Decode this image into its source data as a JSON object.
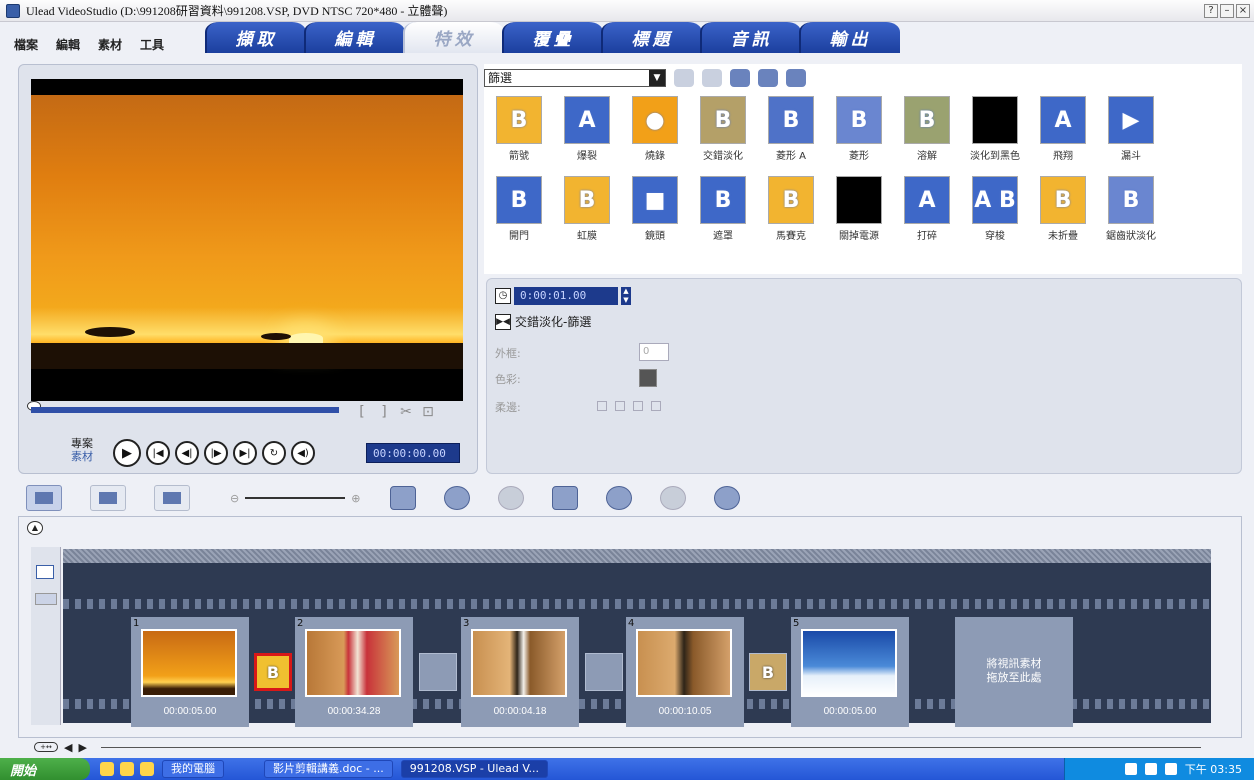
{
  "window": {
    "title": "Ulead VideoStudio (D:\\991208研習資料\\991208.VSP, DVD NTSC 720*480 - 立體聲)",
    "controls": [
      "?",
      "–",
      "×"
    ]
  },
  "menu": [
    "檔案",
    "編輯",
    "素材",
    "工具"
  ],
  "tabs": [
    {
      "label": "擷取",
      "active": false
    },
    {
      "label": "編輯",
      "active": false
    },
    {
      "label": "特效",
      "active": true
    },
    {
      "label": "覆疊",
      "active": false
    },
    {
      "label": "標題",
      "active": false
    },
    {
      "label": "音訊",
      "active": false
    },
    {
      "label": "輸出",
      "active": false
    }
  ],
  "preview": {
    "project_label": "專案",
    "clip_label": "素材",
    "timecode": "00:00:00.00",
    "trim_buttons": [
      "[",
      "]",
      "✂",
      "⊡"
    ]
  },
  "library": {
    "filter": "篩選",
    "effects": [
      {
        "label": "箭號",
        "glyph": "B",
        "color": "#f2b430"
      },
      {
        "label": "爆裂",
        "glyph": "A",
        "color": "#3e68c8"
      },
      {
        "label": "燒錄",
        "glyph": "●",
        "color": "#f2a018"
      },
      {
        "label": "交錯淡化",
        "glyph": "B",
        "color": "#b4a068"
      },
      {
        "label": "菱形 A",
        "glyph": "B",
        "color": "#4f72c8"
      },
      {
        "label": "菱形",
        "glyph": "B",
        "color": "#6a86d0"
      },
      {
        "label": "溶解",
        "glyph": "B",
        "color": "#9aa270"
      },
      {
        "label": "淡化到黑色",
        "glyph": "",
        "color": "#000000"
      },
      {
        "label": "飛翔",
        "glyph": "A",
        "color": "#3e68c8"
      },
      {
        "label": "漏斗",
        "glyph": "▶",
        "color": "#3e68c8"
      },
      {
        "label": "開門",
        "glyph": "B",
        "color": "#3e68c8"
      },
      {
        "label": "虹膜",
        "glyph": "B",
        "color": "#f2b430"
      },
      {
        "label": "鏡頭",
        "glyph": "■",
        "color": "#3e68c8"
      },
      {
        "label": "遮罩",
        "glyph": "B",
        "color": "#3e68c8"
      },
      {
        "label": "馬賽克",
        "glyph": "B",
        "color": "#f2b430"
      },
      {
        "label": "關掉電源",
        "glyph": "",
        "color": "#000000"
      },
      {
        "label": "打碎",
        "glyph": "A",
        "color": "#3e68c8"
      },
      {
        "label": "穿梭",
        "glyph": "A B",
        "color": "#3e68c8"
      },
      {
        "label": "未折疊",
        "glyph": "B",
        "color": "#f2b430"
      },
      {
        "label": "鋸齒狀淡化",
        "glyph": "B",
        "color": "#6a86d0"
      }
    ]
  },
  "options": {
    "duration": "0:00:01.00",
    "effect_name": "交錯淡化-篩選",
    "border_label": "外框:",
    "border_value": "0",
    "color_label": "色彩:",
    "soft_label": "柔邊:"
  },
  "timeline": {
    "clips": [
      {
        "num": "1",
        "duration": "00:00:05.00",
        "scene": "sunset"
      },
      {
        "num": "2",
        "duration": "00:00:34.28",
        "scene": "santa"
      },
      {
        "num": "3",
        "duration": "00:00:04.18",
        "scene": "cello"
      },
      {
        "num": "4",
        "duration": "00:00:10.05",
        "scene": "cello"
      },
      {
        "num": "5",
        "duration": "00:00:05.00",
        "scene": "snow"
      }
    ],
    "drop_hint_1": "將視訊素材",
    "drop_hint_2": "拖放至此處"
  },
  "taskbar": {
    "start": "開始",
    "tasks": [
      "我的電腦",
      "影片剪輯講義.doc - ...",
      "991208.VSP - Ulead V..."
    ],
    "clock": "下午 03:35"
  }
}
